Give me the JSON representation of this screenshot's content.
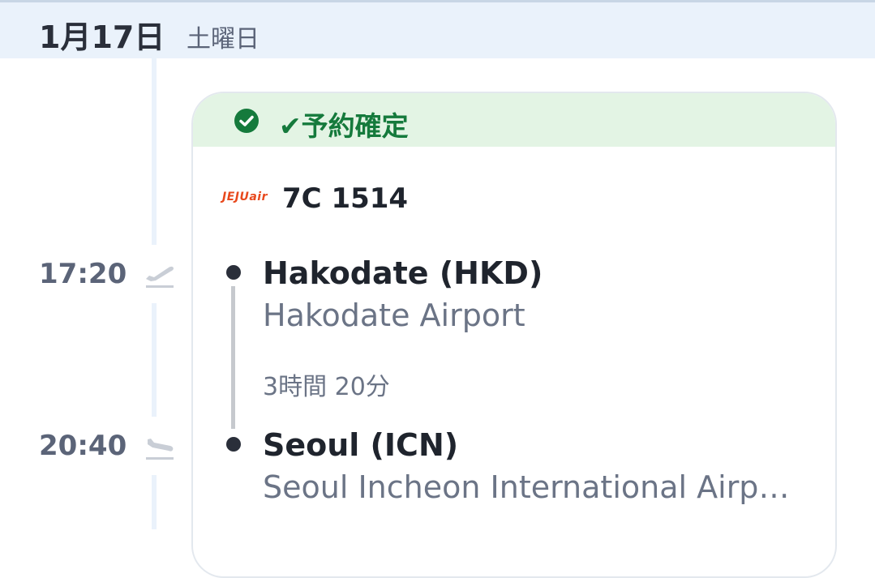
{
  "header": {
    "date": "1月17日",
    "weekday": "土曜日"
  },
  "timeline": {
    "departure_time": "17:20",
    "arrival_time": "20:40"
  },
  "card": {
    "status_icon": "check-circle-icon",
    "status_text": "✔予約確定",
    "status_color": "#157a3c",
    "airline_logo_text": "JEJUair",
    "airline_color": "#e8491d",
    "flight_number": "7C 1514",
    "origin": {
      "city": "Hakodate (HKD)",
      "airport": "Hakodate Airport"
    },
    "duration": "3時間 20分",
    "destination": {
      "city": "Seoul (ICN)",
      "airport": "Seoul Incheon International Airport"
    }
  }
}
